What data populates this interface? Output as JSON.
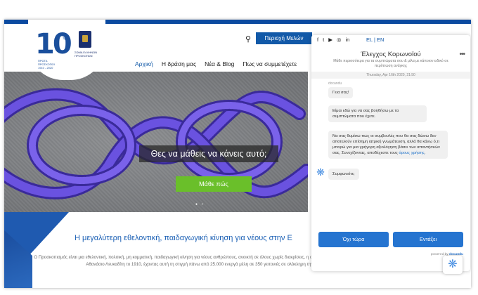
{
  "header": {
    "search_icon": "search-icon",
    "member_area": "Περιοχή Μελών",
    "nav": [
      "Αρχική",
      "Η δράση μας",
      "Νέα & Blog",
      "Πως να συμμετέχετε"
    ],
    "logo": {
      "number": "10",
      "small_text": "ΠΡΩΤΑ ΠΡΟΣΚΟΠΟΙ 1910 - 2020",
      "seal_text": "ΣΩΜΑ ΕΛΛΗΝΩΝ ΠΡΟΣΚΟΠΩΝ"
    }
  },
  "social": {
    "icons": [
      "facebook-icon",
      "twitter-icon",
      "youtube-icon",
      "instagram-icon",
      "linkedin-icon"
    ],
    "glyphs": [
      "f",
      "t",
      "▶",
      "◎",
      "in"
    ],
    "lang": "EL | EN"
  },
  "hero": {
    "title": "Θες να μάθεις να κάνεις αυτό;",
    "button": "Μάθε πώς",
    "dots": "● ○"
  },
  "main": {
    "tagline": "Η μεγαλύτερη εθελοντική, παιδαγωγική κίνηση για νέους στην Ε",
    "description": "Ο Προσκοπισμός είναι μια εθελοντική, πολιτική, μη κομματική, παιδαγωγική κίνηση για νέους ανθρώπους, ανοικτή σε όλους χωρίς διακρίσεις, η οποία ιδρύθηκε στην Ελλάδα από τον Αθανάσιο Λευκαδίτη το 1910, έχοντας αυτή τη στιγμή πάνω από 25.000 ενεργά μέλη σε 350 γειτονιές σε ολόκληρη την Ελλάδα."
  },
  "chat": {
    "title": "Έλεγχος Κορωνοϊού",
    "subtitle": "Μάθε περισσότερα για τα συμπτώματα σου & μίλα με κάποιον ειδικό σε περίπτωση ανάγκης",
    "menu": "•••",
    "timestamp": "Thursday, Apr 16th 2020, 21:50",
    "sender": "docandu",
    "messages": [
      "Γεια σας!",
      "Είμαι εδώ για να σας βοηθήσω με τα συμπτώματα που έχετε.",
      "Να σας θυμίσω πως οι συμβουλές που θα σας δώσω δεν αποτελούν επίσημη ιατρική γνωμάτευση, αλλά θα κάνω ό,τι μπορώ για μια γρήγορη αξιολόγηση βάσει των απαντήσεών σας. Συνεχίζοντας, αποδέχεστε τους",
      "Συμφωνείτε;"
    ],
    "terms_link": "όρους χρήσης",
    "terms_end": ".",
    "buttons": {
      "decline": "Όχι τώρα",
      "accept": "Εντάξει"
    },
    "powered_by": "powered by",
    "brand": "docandu"
  },
  "colors": {
    "brand_blue": "#1259a8",
    "hero_button": "#6abf2a",
    "chat_button": "#2574d0",
    "rope": "#5a3fd0"
  }
}
